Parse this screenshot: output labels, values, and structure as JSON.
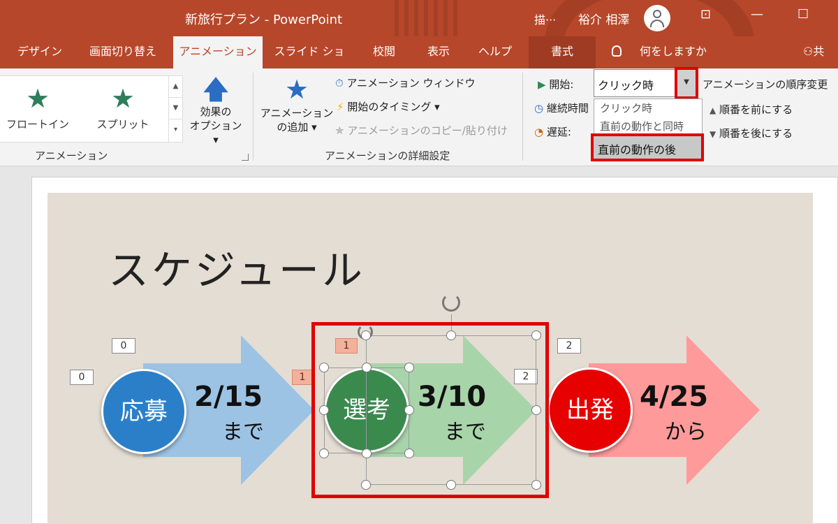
{
  "window": {
    "title": "新旅行プラン  -  PowerPoint",
    "draw_label": "描···",
    "user_name": "裕介 相澤"
  },
  "tabs": [
    {
      "label": "デザイン"
    },
    {
      "label": "画面切り替え"
    },
    {
      "label": "アニメーション"
    },
    {
      "label": "スライド ショー"
    },
    {
      "label": "校閲"
    },
    {
      "label": "表示"
    },
    {
      "label": "ヘルプ"
    },
    {
      "label": "書式"
    }
  ],
  "tell_me": "何をしますか",
  "share": "共",
  "ribbon": {
    "animation_gallery": [
      {
        "label": "フロートイン",
        "icon": "star-icon"
      },
      {
        "label": "スプリット",
        "icon": "star-split-icon"
      }
    ],
    "effect_options_line1": "効果の",
    "effect_options_line2": "オプション ▾",
    "group_animation": "アニメーション",
    "add_animation_line1": "アニメーション",
    "add_animation_line2": "の追加 ▾",
    "animation_pane": "アニメーション ウィンドウ",
    "trigger": "開始のタイミング ▾",
    "animation_painter": "アニメーションのコピー/貼り付け",
    "group_advanced": "アニメーションの詳細設定",
    "start_label": "開始:",
    "start_value": "クリック時",
    "duration_label": "継続時間",
    "delay_label": "遅延:",
    "dropdown_options": [
      "クリック時",
      "直前の動作と同時",
      "直前の動作の後"
    ],
    "reorder_title": "アニメーションの順序変更",
    "move_earlier": "順番を前にする",
    "move_later": "順番を後にする"
  },
  "slide": {
    "title": "スケジュール",
    "steps": [
      {
        "circle": "応募",
        "date": "2/15",
        "sub": "まで",
        "color": "#2b7fc8",
        "arrow_color": "#9cc3e4"
      },
      {
        "circle": "選考",
        "date": "3/10",
        "sub": "まで",
        "color": "#3a8a4e",
        "arrow_color": "#a8d4aa"
      },
      {
        "circle": "出発",
        "date": "4/25",
        "sub": "から",
        "color": "#e60000",
        "arrow_color": "#ff9a9a"
      }
    ],
    "tags": [
      "0",
      "0",
      "1",
      "1",
      "2",
      "2"
    ]
  }
}
